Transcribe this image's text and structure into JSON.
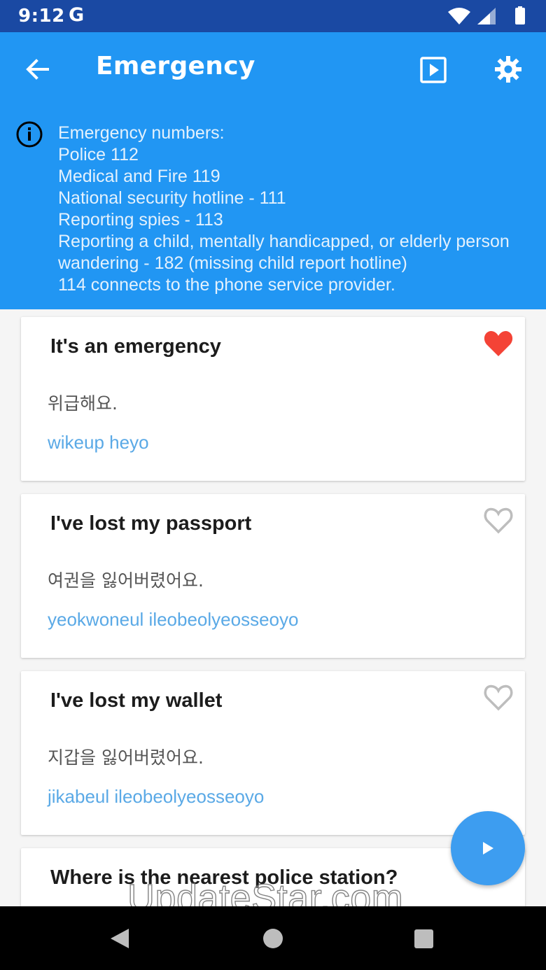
{
  "status_bar": {
    "time": "9:12",
    "g_label": "G"
  },
  "app_bar": {
    "title": "Emergency"
  },
  "info": {
    "lines": [
      "Emergency numbers:",
      "Police 112",
      "Medical and Fire 119",
      "National security hotline - 111",
      "Reporting spies - 113",
      "Reporting a child, mentally handicapped, or elderly person",
      "wandering - 182 (missing child report hotline)",
      "114 connects to the phone service provider."
    ]
  },
  "phrases": [
    {
      "english": "It's an emergency",
      "korean": "위급해요.",
      "romanization": "wikeup heyo",
      "favorited": true
    },
    {
      "english": "I've lost my passport",
      "korean": "여권을 잃어버렸어요.",
      "romanization": "yeokwoneul ileobeolyeosseoyo",
      "favorited": false
    },
    {
      "english": "I've lost my wallet",
      "korean": "지갑을 잃어버렸어요.",
      "romanization": "jikabeul ileobeolyeosseoyo",
      "favorited": false
    },
    {
      "english": "Where is the nearest police station?",
      "favorited": false
    }
  ],
  "watermark": "UpdateStar.com",
  "colors": {
    "primary": "#2196f3",
    "status_bar": "#1a49a3",
    "romanization": "#5aa9e6",
    "heart_filled": "#f44336",
    "heart_outline": "#bdbdbd"
  }
}
